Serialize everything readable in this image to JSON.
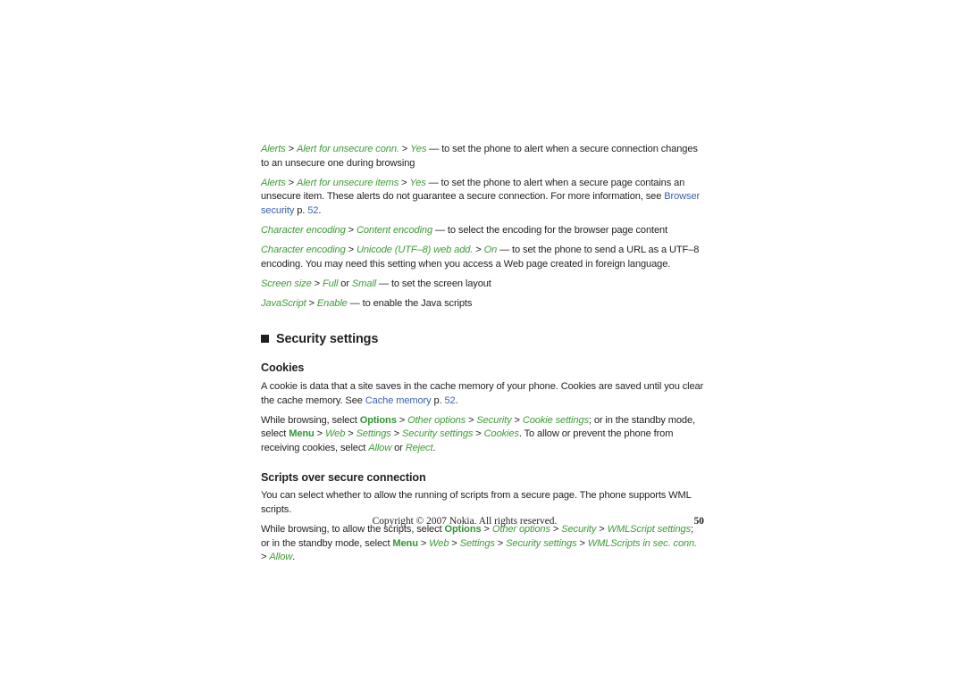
{
  "document": {
    "page_number": "50",
    "footer_copyright": "Copyright © 2007 Nokia. All rights reserved."
  },
  "colors": {
    "green": "#3f9b37",
    "green_bold": "#2f9733",
    "link_blue": "#3b62b0",
    "text": "#231f20",
    "background": "#ffffff"
  },
  "bullets": [
    {
      "id": "alert-unsecure-conn",
      "runs": [
        {
          "text": "Alerts",
          "style": "green-italic"
        },
        {
          "text": " > ",
          "style": "sep"
        },
        {
          "text": "Alert for unsecure conn.",
          "style": "green-italic"
        },
        {
          "text": " > ",
          "style": "sep"
        },
        {
          "text": "Yes",
          "style": "green-italic"
        },
        {
          "text": " — to set the phone to alert when a secure connection changes to an unsecure one during browsing",
          "style": "plain"
        }
      ]
    },
    {
      "id": "alert-unsecure-items",
      "runs": [
        {
          "text": "Alerts",
          "style": "green-italic"
        },
        {
          "text": " > ",
          "style": "sep"
        },
        {
          "text": "Alert for unsecure items",
          "style": "green-italic"
        },
        {
          "text": " > ",
          "style": "sep"
        },
        {
          "text": "Yes",
          "style": "green-italic"
        },
        {
          "text": " — to set the phone to alert when a secure page contains an unsecure item. These alerts do not guarantee a secure connection. For more information, see ",
          "style": "plain"
        },
        {
          "text": "Browser security",
          "style": "link"
        },
        {
          "text": " p. ",
          "style": "plain"
        },
        {
          "text": "52",
          "style": "link"
        },
        {
          "text": ".",
          "style": "plain"
        }
      ]
    },
    {
      "id": "content-encoding",
      "runs": [
        {
          "text": "Character encoding",
          "style": "green-italic"
        },
        {
          "text": " > ",
          "style": "sep"
        },
        {
          "text": "Content encoding",
          "style": "green-italic"
        },
        {
          "text": " — to select the encoding for the browser page content",
          "style": "plain"
        }
      ]
    },
    {
      "id": "unicode-web-add",
      "runs": [
        {
          "text": "Character encoding",
          "style": "green-italic"
        },
        {
          "text": " > ",
          "style": "sep"
        },
        {
          "text": "Unicode (UTF–8) web add.",
          "style": "green-italic"
        },
        {
          "text": " > ",
          "style": "sep"
        },
        {
          "text": "On",
          "style": "green-italic"
        },
        {
          "text": " — to set the phone to send a URL as a UTF–8 encoding. You may need this setting when you access a Web page created in foreign language.",
          "style": "plain"
        }
      ]
    },
    {
      "id": "screen-size",
      "runs": [
        {
          "text": "Screen size",
          "style": "green-italic"
        },
        {
          "text": " > ",
          "style": "sep"
        },
        {
          "text": "Full",
          "style": "green-italic"
        },
        {
          "text": " or ",
          "style": "plain"
        },
        {
          "text": "Small",
          "style": "green-italic"
        },
        {
          "text": " — to set the screen layout",
          "style": "plain"
        }
      ]
    },
    {
      "id": "javascript",
      "runs": [
        {
          "text": "JavaScript",
          "style": "green-italic"
        },
        {
          "text": " > ",
          "style": "sep"
        },
        {
          "text": "Enable",
          "style": "green-italic"
        },
        {
          "text": " — to enable the Java scripts",
          "style": "plain"
        }
      ]
    }
  ],
  "section": {
    "heading": "Security settings",
    "bullet_icon": "filled-square-icon",
    "subsections": [
      {
        "id": "cookies",
        "heading": "Cookies",
        "paragraphs": [
          {
            "id": "cookies-intro",
            "runs": [
              {
                "text": "A cookie is data that a site saves in the cache memory of your phone. Cookies are saved until you clear the cache memory. See ",
                "style": "plain"
              },
              {
                "text": "Cache memory",
                "style": "link"
              },
              {
                "text": " p. ",
                "style": "plain"
              },
              {
                "text": "52",
                "style": "link"
              },
              {
                "text": ".",
                "style": "plain"
              }
            ]
          },
          {
            "id": "cookies-path",
            "runs": [
              {
                "text": "While browsing, select ",
                "style": "plain"
              },
              {
                "text": "Options",
                "style": "green-bold"
              },
              {
                "text": " > ",
                "style": "sep"
              },
              {
                "text": "Other options",
                "style": "green-italic"
              },
              {
                "text": " > ",
                "style": "sep"
              },
              {
                "text": "Security",
                "style": "green-italic"
              },
              {
                "text": " > ",
                "style": "sep"
              },
              {
                "text": "Cookie settings",
                "style": "green-italic"
              },
              {
                "text": "; or in the standby mode, select ",
                "style": "plain"
              },
              {
                "text": "Menu",
                "style": "green-bold"
              },
              {
                "text": " > ",
                "style": "sep"
              },
              {
                "text": "Web",
                "style": "green-italic"
              },
              {
                "text": " > ",
                "style": "sep"
              },
              {
                "text": "Settings",
                "style": "green-italic"
              },
              {
                "text": " > ",
                "style": "sep"
              },
              {
                "text": "Security settings",
                "style": "green-italic"
              },
              {
                "text": " > ",
                "style": "sep"
              },
              {
                "text": "Cookies",
                "style": "green-italic"
              },
              {
                "text": ". To allow or prevent the phone from receiving cookies, select ",
                "style": "plain"
              },
              {
                "text": "Allow",
                "style": "green-italic"
              },
              {
                "text": " or ",
                "style": "plain"
              },
              {
                "text": "Reject",
                "style": "green-italic"
              },
              {
                "text": ".",
                "style": "plain"
              }
            ]
          }
        ]
      },
      {
        "id": "scripts-over-secure-connection",
        "heading": "Scripts over secure connection",
        "paragraphs": [
          {
            "id": "scripts-intro",
            "runs": [
              {
                "text": "You can select whether to allow the running of scripts from a secure page. The phone supports WML scripts.",
                "style": "plain"
              }
            ]
          },
          {
            "id": "scripts-path",
            "runs": [
              {
                "text": "While browsing, to allow the scripts, select ",
                "style": "plain"
              },
              {
                "text": "Options",
                "style": "green-bold"
              },
              {
                "text": " > ",
                "style": "sep"
              },
              {
                "text": "Other options",
                "style": "green-italic"
              },
              {
                "text": " > ",
                "style": "sep"
              },
              {
                "text": "Security",
                "style": "green-italic"
              },
              {
                "text": " > ",
                "style": "sep"
              },
              {
                "text": "WMLScript settings",
                "style": "green-italic"
              },
              {
                "text": "; or in the standby mode, select ",
                "style": "plain"
              },
              {
                "text": "Menu",
                "style": "green-bold"
              },
              {
                "text": " > ",
                "style": "sep"
              },
              {
                "text": "Web",
                "style": "green-italic"
              },
              {
                "text": " > ",
                "style": "sep"
              },
              {
                "text": "Settings",
                "style": "green-italic"
              },
              {
                "text": " > ",
                "style": "sep"
              },
              {
                "text": "Security settings",
                "style": "green-italic"
              },
              {
                "text": " > ",
                "style": "sep"
              },
              {
                "text": "WMLScripts in sec. conn.",
                "style": "green-italic"
              },
              {
                "text": " > ",
                "style": "sep"
              },
              {
                "text": "Allow",
                "style": "green-italic"
              },
              {
                "text": ".",
                "style": "plain"
              }
            ]
          }
        ]
      }
    ]
  }
}
